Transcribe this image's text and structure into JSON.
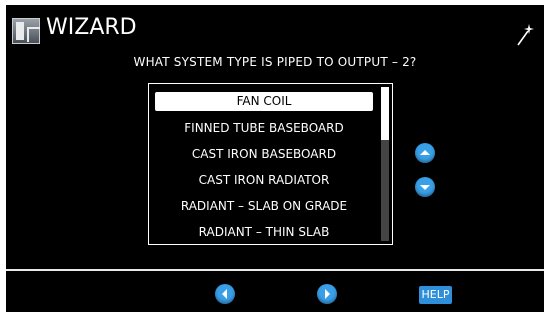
{
  "header": {
    "title": "WIZARD",
    "logo_icon": "logo-icon",
    "wand_icon": "magic-wand-icon"
  },
  "question": "WHAT SYSTEM TYPE IS PIPED TO OUTPUT – 2?",
  "system_types": [
    "FAN COIL",
    "FINNED TUBE BASEBOARD",
    "CAST IRON BASEBOARD",
    "CAST IRON RADIATOR",
    "RADIANT – SLAB ON GRADE",
    "RADIANT – THIN SLAB"
  ],
  "selected_system_type": "FAN COIL",
  "footer": {
    "help_label": "HELP"
  },
  "colors": {
    "background": "#000000",
    "accent": "#39a0e8",
    "text": "#ffffff"
  }
}
